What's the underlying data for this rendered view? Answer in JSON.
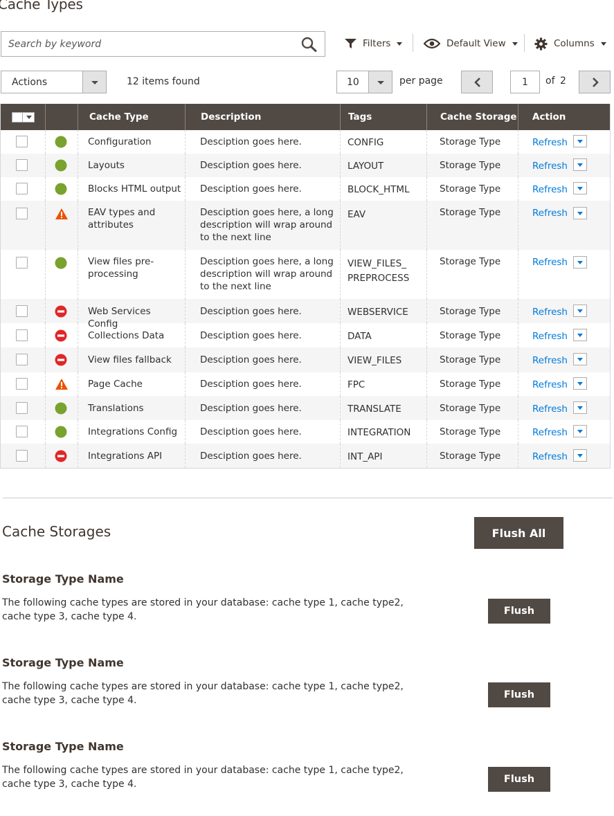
{
  "page": {
    "title": "Cache Types"
  },
  "search": {
    "placeholder": "Search by keyword"
  },
  "toolbar": {
    "filters_label": "Filters",
    "view_label": "Default View",
    "columns_label": "Columns"
  },
  "actions": {
    "label": "Actions",
    "items_found": "12 items found"
  },
  "pagination": {
    "per_page_value": "10",
    "per_page_label": "per page",
    "current_page": "1",
    "of_label": "of",
    "total_pages": "2"
  },
  "grid": {
    "columns": [
      "Cache Type",
      "Description",
      "Tags",
      "Cache Storage",
      "Action"
    ],
    "rows": [
      {
        "cache_type": "Configuration",
        "status": "enabled",
        "description": "Desciption goes here.",
        "tags": "CONFIG",
        "storage": "Storage Type",
        "action": "Refresh"
      },
      {
        "cache_type": "Layouts",
        "status": "enabled",
        "description": "Desciption goes here.",
        "tags": "LAYOUT",
        "storage": "Storage Type",
        "action": "Refresh"
      },
      {
        "cache_type": "Blocks HTML output",
        "status": "enabled",
        "description": "Desciption goes here.",
        "tags": "BLOCK_HTML",
        "storage": "Storage Type",
        "action": "Refresh"
      },
      {
        "cache_type": "EAV types and attributes",
        "status": "warning",
        "description": "Desciption goes here, a long description will wrap around to the next line",
        "tags": "EAV",
        "storage": "Storage Type",
        "action": "Refresh"
      },
      {
        "cache_type": "View files pre-processing",
        "status": "enabled",
        "description": "Desciption goes here, a long description will wrap around to the next line",
        "tags": "VIEW_FILES_ PREPROCESS",
        "storage": "Storage Type",
        "action": "Refresh"
      },
      {
        "cache_type": "Web Services Config",
        "status": "disabled",
        "description": "Desciption goes here.",
        "tags": "WEBSERVICE",
        "storage": "Storage Type",
        "action": "Refresh"
      },
      {
        "cache_type": "Collections Data",
        "status": "disabled",
        "description": "Desciption goes here.",
        "tags": "DATA",
        "storage": "Storage Type",
        "action": "Refresh"
      },
      {
        "cache_type": "View files fallback",
        "status": "disabled",
        "description": "Desciption goes here.",
        "tags": "VIEW_FILES",
        "storage": "Storage Type",
        "action": "Refresh"
      },
      {
        "cache_type": "Page Cache",
        "status": "warning",
        "description": "Desciption goes here.",
        "tags": "FPC",
        "storage": "Storage Type",
        "action": "Refresh"
      },
      {
        "cache_type": "Translations",
        "status": "enabled",
        "description": "Desciption goes here.",
        "tags": "TRANSLATE",
        "storage": "Storage Type",
        "action": "Refresh"
      },
      {
        "cache_type": "Integrations Config",
        "status": "enabled",
        "description": "Desciption goes here.",
        "tags": "INTEGRATION",
        "storage": "Storage Type",
        "action": "Refresh"
      },
      {
        "cache_type": "Integrations API",
        "status": "disabled",
        "description": "Desciption goes here.",
        "tags": "INT_API",
        "storage": "Storage Type",
        "action": "Refresh"
      }
    ]
  },
  "storages": {
    "title": "Cache Storages",
    "flush_all_label": "Flush All",
    "items": [
      {
        "name": "Storage Type Name",
        "description": "The following cache types are stored in your database: cache type 1, cache type2, cache type 3, cache type 4.",
        "button": "Flush"
      },
      {
        "name": "Storage Type Name",
        "description": "The following cache types are stored in your database: cache type 1, cache type2, cache type 3, cache type 4.",
        "button": "Flush"
      },
      {
        "name": "Storage Type Name",
        "description": "The following cache types are stored in your database: cache type 1, cache type2, cache type 3, cache type 4.",
        "button": "Flush"
      }
    ]
  },
  "colors": {
    "header_bg": "#514943",
    "link": "#007bdb",
    "enabled": "#79a22e",
    "warning": "#eb5202",
    "disabled": "#e22626"
  },
  "icons": {
    "search": "search-icon",
    "filters": "funnel-icon",
    "view": "eye-icon",
    "columns": "gear-icon",
    "prev": "chevron-left-icon",
    "next": "chevron-right-icon",
    "enabled": "status-enabled-icon",
    "warning": "status-warning-icon",
    "disabled": "status-disabled-icon"
  }
}
